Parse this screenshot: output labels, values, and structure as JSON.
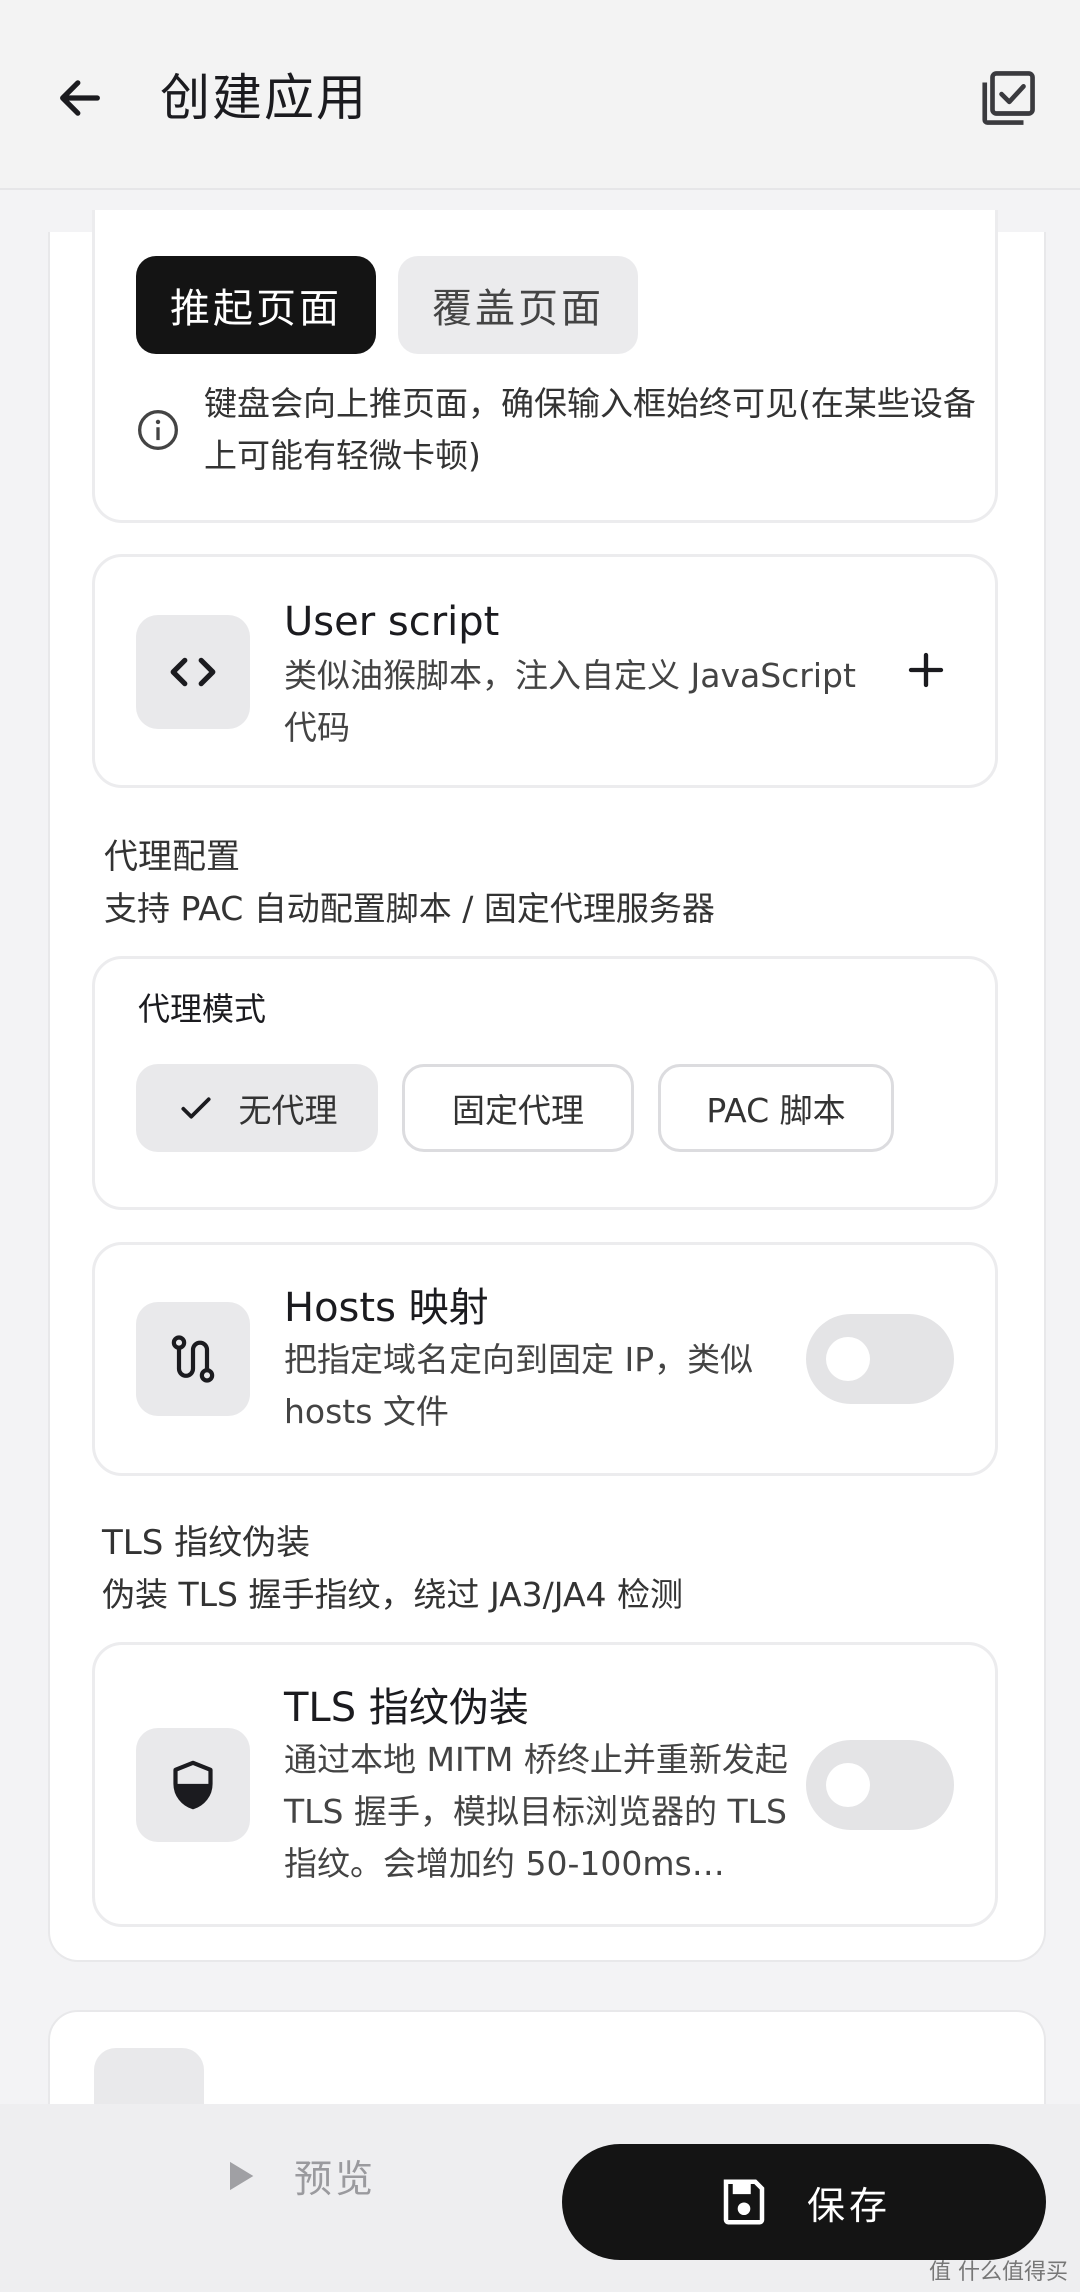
{
  "app": {
    "title": "创建应用"
  },
  "keyboard": {
    "push_label": "推起页面",
    "cover_label": "覆盖页面",
    "info": "键盘会向上推页面，确保输入框始终可见(在某些设备上可能有轻微卡顿)"
  },
  "user_script": {
    "title": "User script",
    "desc": "类似油猴脚本，注入自定义 JavaScript 代码",
    "add_glyph": "+"
  },
  "proxy": {
    "section_title": "代理配置",
    "section_desc": "支持 PAC 自动配置脚本 / 固定代理服务器",
    "mode_label": "代理模式",
    "options": [
      "无代理",
      "固定代理",
      "PAC 脚本"
    ],
    "selected": "无代理"
  },
  "hosts": {
    "title": "Hosts 映射",
    "desc": "把指定域名定向到固定 IP，类似 hosts 文件",
    "enabled": false
  },
  "tls": {
    "section_title": "TLS 指纹伪装",
    "section_desc": "伪装 TLS 握手指纹，绕过 JA3/JA4 检测",
    "title": "TLS 指纹伪装",
    "desc": "通过本地 MITM 桥终止并重新发起 TLS 握手，模拟目标浏览器的 TLS 指纹。会增加约 50-100ms…",
    "enabled": false
  },
  "bottom": {
    "preview_label": "预览",
    "save_label": "保存"
  },
  "watermark": "值 什么值得买",
  "icons": {
    "back": "arrow-left-icon",
    "check": "checklist-icon",
    "info": "info-icon",
    "code": "code-icon",
    "add": "plus-icon",
    "route": "route-icon",
    "shield": "shield-icon",
    "play": "play-icon",
    "save": "floppy-disk-icon"
  },
  "colors": {
    "primary": "#141414",
    "surface": "#ffffff",
    "background": "#f3f3f5"
  }
}
